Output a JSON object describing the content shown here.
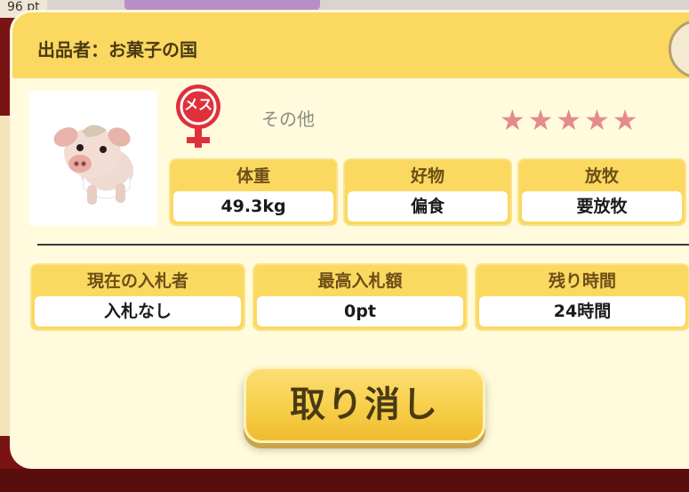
{
  "background": {
    "points_text": "96 pt"
  },
  "dialog": {
    "seller": "出品者：お菓子の国",
    "gender_badge": "メス",
    "category": "その他",
    "stars_text": "★★★★★",
    "stat_rating": 5,
    "stats_top": [
      {
        "label": "体重",
        "value": "49.3kg"
      },
      {
        "label": "好物",
        "value": "偏食"
      },
      {
        "label": "放牧",
        "value": "要放牧"
      }
    ],
    "stats_bottom": [
      {
        "label": "現在の入札者",
        "value": "入札なし"
      },
      {
        "label": "最高入札額",
        "value": "0pt"
      },
      {
        "label": "残り時間",
        "value": "24時間"
      }
    ],
    "cancel_label": "取り消し"
  },
  "colors": {
    "header": "#fbd860",
    "panel": "#fffbdc",
    "badge": "#e0303b",
    "stars": "#e48b8b"
  },
  "icons": {
    "gender": "female-icon",
    "close": "close-icon"
  }
}
